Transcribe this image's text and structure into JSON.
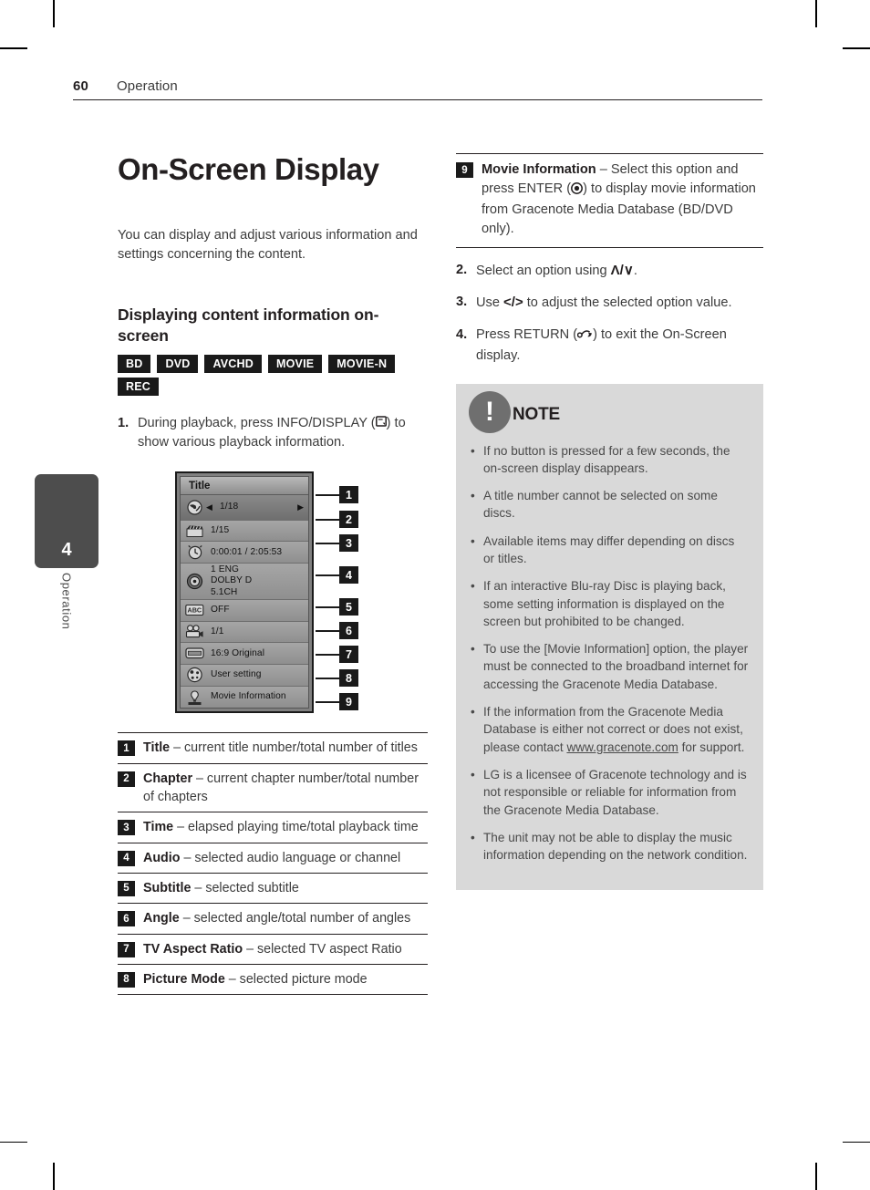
{
  "header": {
    "page_number": "60",
    "section": "Operation"
  },
  "chapter_tab": {
    "number": "4",
    "label": "Operation"
  },
  "left": {
    "title": "On-Screen Display",
    "intro": "You can display and adjust various information and settings concerning the content.",
    "subheading": "Displaying content information on-screen",
    "badges": [
      "BD",
      "DVD",
      "AVCHD",
      "MOVIE",
      "MOVIE-N",
      "REC"
    ],
    "step1_num": "1.",
    "step1_text_a": "During playback, press INFO/DISPLAY (",
    "step1_text_b": ") to show various playback information."
  },
  "osd": {
    "title": "Title",
    "rows": [
      {
        "icon": "disc-title-icon",
        "value": "1/18",
        "selected": true,
        "arrows": true
      },
      {
        "icon": "clapperboard-icon",
        "value": "1/15",
        "selected": false,
        "arrows": false
      },
      {
        "icon": "clock-icon",
        "value": "0:00:01 / 2:05:53",
        "selected": false,
        "arrows": false
      },
      {
        "icon": "audio-disc-icon",
        "value": "1 ENG\nDOLBY D\n5.1CH",
        "selected": false,
        "arrows": false
      },
      {
        "icon": "subtitle-abc-icon",
        "value": "OFF",
        "selected": false,
        "arrows": false
      },
      {
        "icon": "camera-angle-icon",
        "value": "1/1",
        "selected": false,
        "arrows": false
      },
      {
        "icon": "tv-aspect-icon",
        "value": "16:9 Original",
        "selected": false,
        "arrows": false
      },
      {
        "icon": "picture-mode-icon",
        "value": "User setting",
        "selected": false,
        "arrows": false
      },
      {
        "icon": "movie-info-icon",
        "value": "Movie Information",
        "selected": false,
        "arrows": false
      }
    ],
    "callouts": [
      "1",
      "2",
      "3",
      "4",
      "5",
      "6",
      "7",
      "8",
      "9"
    ]
  },
  "definitions": [
    {
      "num": "1",
      "term": "Title",
      "desc": " – current title number/total number of titles"
    },
    {
      "num": "2",
      "term": "Chapter",
      "desc": " – current chapter number/total number of chapters"
    },
    {
      "num": "3",
      "term": "Time",
      "desc": " – elapsed playing time/total playback time"
    },
    {
      "num": "4",
      "term": "Audio",
      "desc": " – selected audio language or channel"
    },
    {
      "num": "5",
      "term": "Subtitle",
      "desc": " – selected subtitle"
    },
    {
      "num": "6",
      "term": "Angle",
      "desc": " – selected angle/total number of angles"
    },
    {
      "num": "7",
      "term": "TV Aspect Ratio",
      "desc": " – selected TV aspect Ratio"
    },
    {
      "num": "8",
      "term": "Picture Mode",
      "desc": " – selected picture mode"
    }
  ],
  "right": {
    "movie_info": {
      "num": "9",
      "term": "Movie Information",
      "desc_a": " – Select this option and press ENTER (",
      "desc_b": ") to display movie information from Gracenote Media Database (BD/DVD only)."
    },
    "steps": [
      {
        "num": "2.",
        "text_a": "Select an option using ",
        "symbol": "Λ/∨",
        "text_b": "."
      },
      {
        "num": "3.",
        "text_a": "Use ",
        "symbol": "</>",
        "text_b": " to adjust the selected option value."
      },
      {
        "num": "4.",
        "text_a": "Press RETURN (",
        "symbol": "",
        "text_b": ") to exit the On-Screen display."
      }
    ],
    "note": {
      "title": "NOTE",
      "items": [
        {
          "text": "If no button is pressed for a few seconds, the on-screen display disappears."
        },
        {
          "text": "A title number cannot be selected on some discs."
        },
        {
          "text": "Available items may differ depending on discs or titles."
        },
        {
          "text": "If an interactive Blu-ray Disc is playing back, some setting information is displayed on the screen but prohibited to be changed."
        },
        {
          "text": "To use the [Movie Information] option, the player must be connected to the broadband internet for accessing the Gracenote Media Database."
        },
        {
          "text_a": "If the information from the Gracenote Media Database is either not correct or does not exist, please contact ",
          "link": "www.gracenote.com",
          "text_b": " for support."
        },
        {
          "text": "LG is a licensee of Gracenote technology and is not responsible or reliable for information from the Gracenote Media Database."
        },
        {
          "text": "The unit may not be able to display the music information depending on the network condition."
        }
      ]
    }
  },
  "colors": {
    "text": "#231f20",
    "body_text": "#3c3c3c",
    "badge_bg": "#1a1a1a",
    "note_bg": "#d9d9d9",
    "note_icon": "#6f6f6f",
    "tab_bg": "#4d4d4d"
  }
}
